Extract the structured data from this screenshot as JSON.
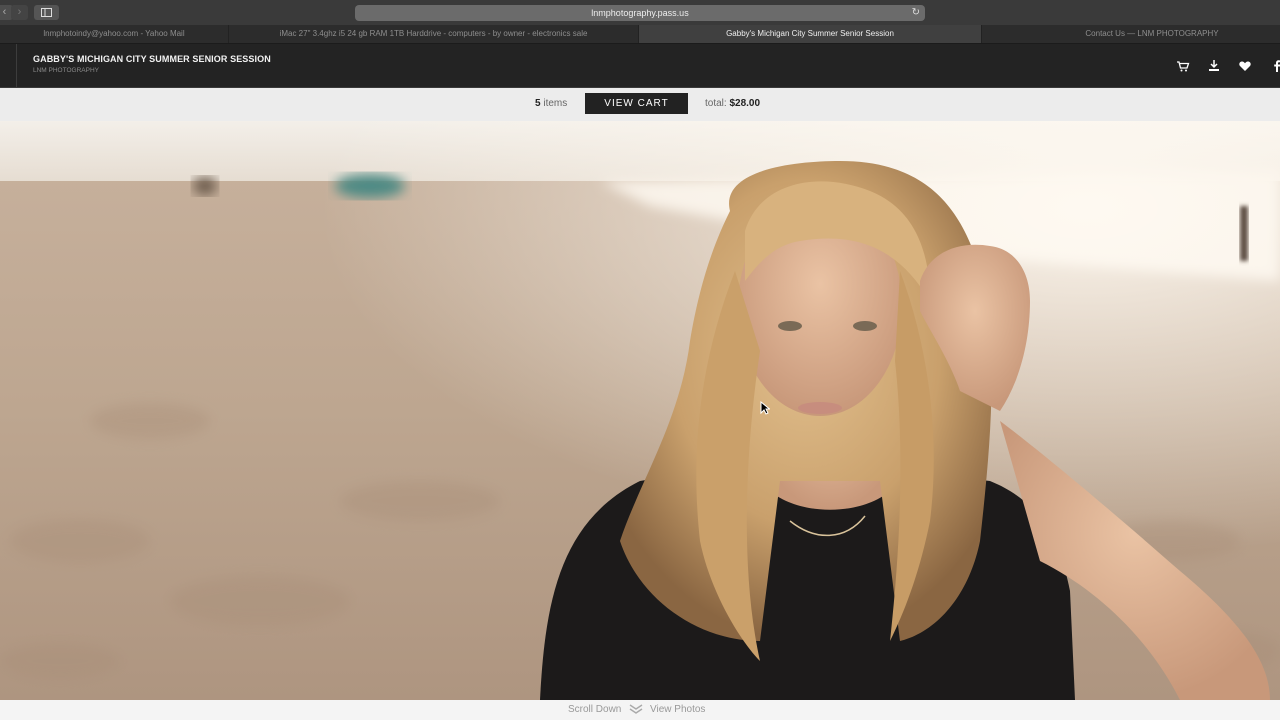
{
  "browser": {
    "url": "lnmphotography.pass.us",
    "tabs": [
      {
        "label": "lnmphotoindy@yahoo.com - Yahoo Mail"
      },
      {
        "label": "iMac 27\" 3.4ghz i5 24 gb RAM 1TB Harddrive - computers - by owner - electronics sale"
      },
      {
        "label": "Gabby's Michigan City Summer Senior Session"
      },
      {
        "label": "Contact Us — LNM PHOTOGRAPHY"
      }
    ]
  },
  "header": {
    "title": "GABBY'S MICHIGAN CITY SUMMER SENIOR SESSION",
    "subtitle": "LNM PHOTOGRAPHY",
    "icons": [
      "cart-icon",
      "download-icon",
      "heart-icon",
      "facebook-icon"
    ]
  },
  "cart": {
    "count": "5",
    "items_label": "items",
    "button": "VIEW CART",
    "total_label": "total:",
    "total_value": "$28.00"
  },
  "footer": {
    "scroll_down": "Scroll Down",
    "view_photos": "View Photos"
  }
}
